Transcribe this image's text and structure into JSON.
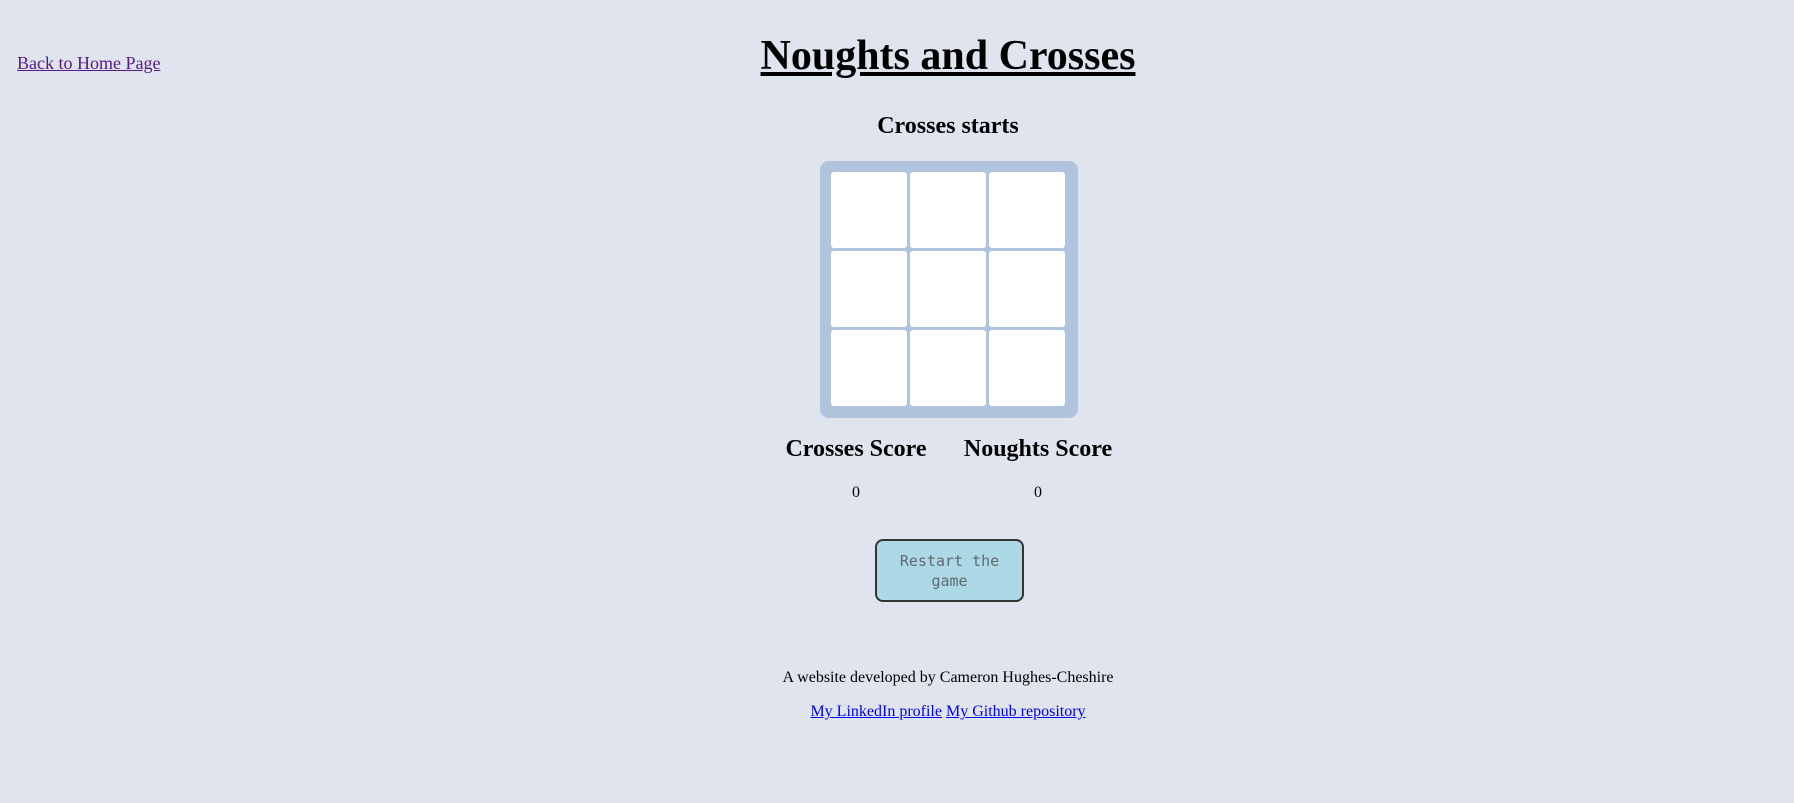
{
  "nav": {
    "home_link": "Back to Home Page"
  },
  "header": {
    "title": "Noughts and Crosses",
    "status": "Crosses starts"
  },
  "board": {
    "cells": [
      "",
      "",
      "",
      "",
      "",
      "",
      "",
      "",
      ""
    ]
  },
  "scores": {
    "crosses_label": "Crosses Score",
    "crosses_value": "0",
    "noughts_label": "Noughts Score",
    "noughts_value": "0"
  },
  "controls": {
    "restart_label": "Restart the game"
  },
  "footer": {
    "credit": "A website developed by Cameron Hughes-Cheshire",
    "linkedin_label": "My LinkedIn profile",
    "github_label": "My Github repository"
  },
  "colors": {
    "background": "#dfe4ee",
    "board": "#b0c4de",
    "cell": "#ffffff",
    "restart_button": "#add8e6",
    "visited_link": "#551a8b",
    "link": "#0000ee"
  }
}
